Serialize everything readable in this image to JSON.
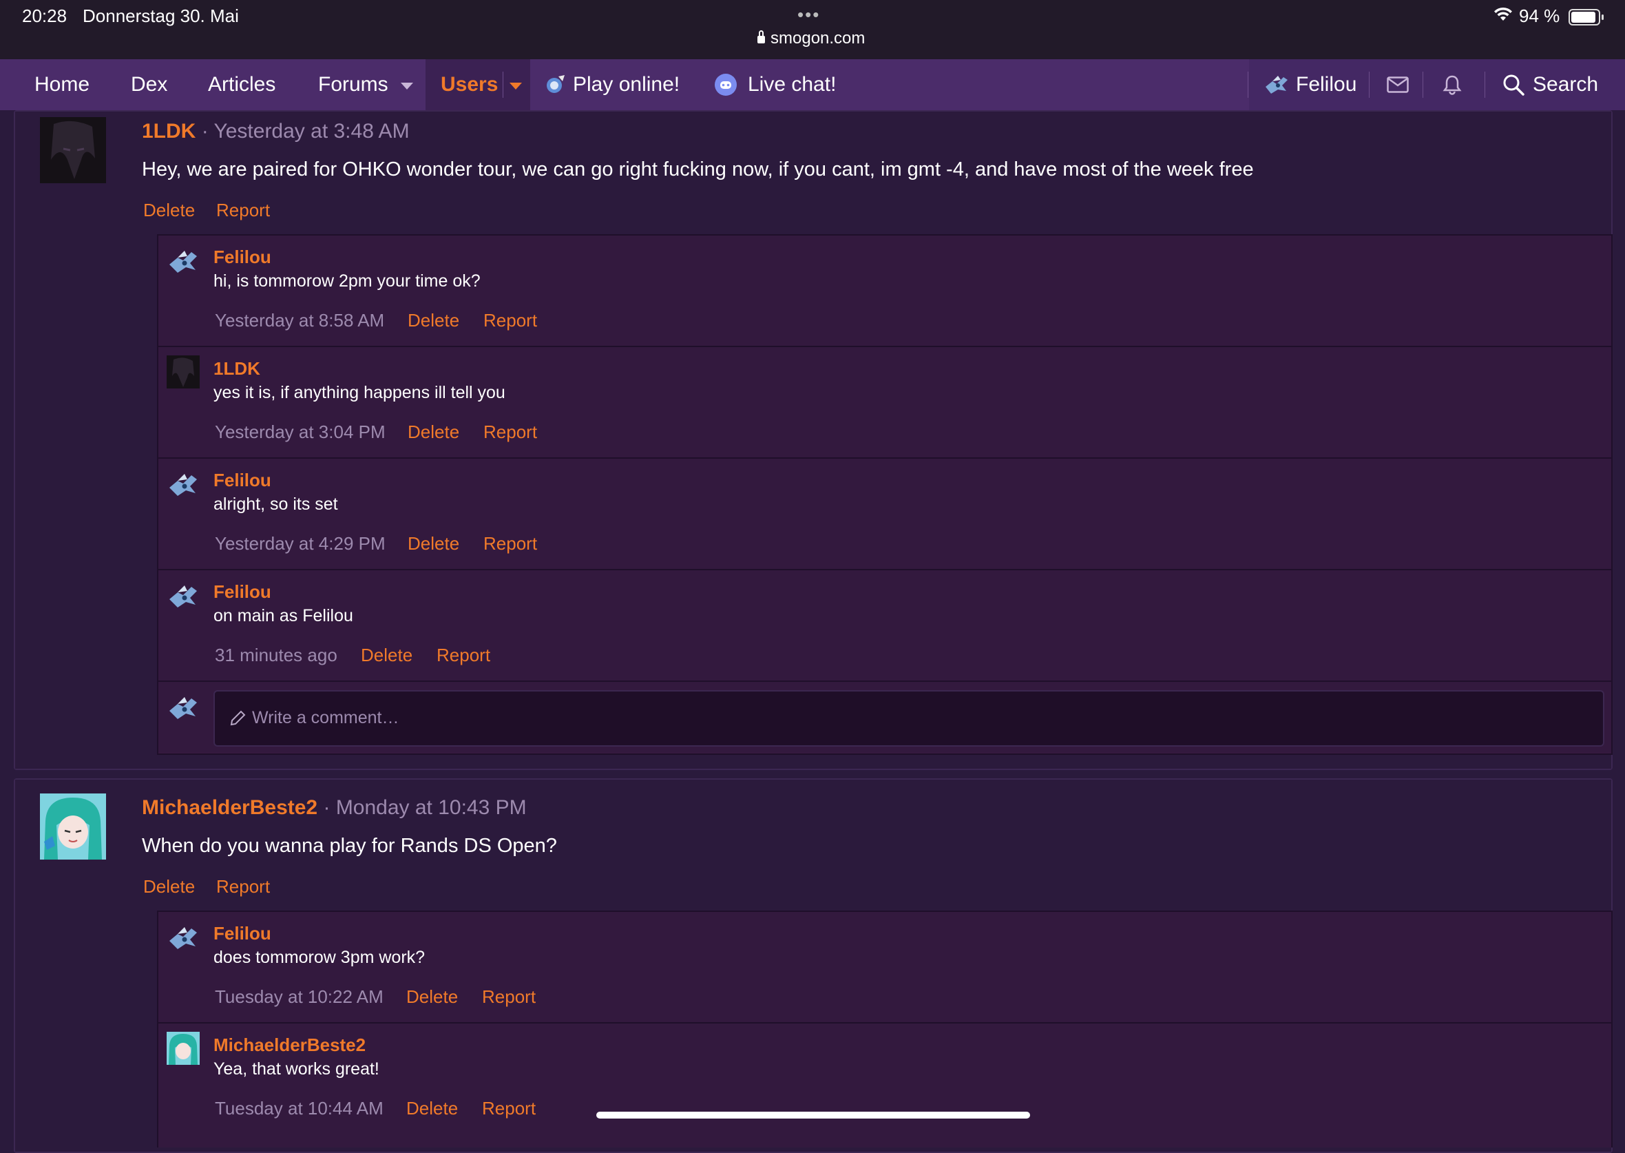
{
  "status_bar": {
    "time": "20:28",
    "date": "Donnerstag 30. Mai",
    "dots": "•••",
    "url": "smogon.com",
    "battery": "94 %"
  },
  "nav": {
    "home": "Home",
    "dex": "Dex",
    "articles": "Articles",
    "forums": "Forums",
    "users": "Users",
    "play_online": "Play online!",
    "live_chat": "Live chat!",
    "username": "Felilou",
    "search": "Search"
  },
  "posts": [
    {
      "author": "1LDK",
      "separator": "·",
      "time": "Yesterday at 3:48 AM",
      "text": "Hey, we are paired for OHKO wonder tour, we can go right fucking now, if you cant, im gmt -4, and have most of the week free",
      "delete": "Delete",
      "report": "Report",
      "comments": [
        {
          "author": "Felilou",
          "text": "hi, is tommorow 2pm your time ok?",
          "time": "Yesterday at 8:58 AM",
          "delete": "Delete",
          "report": "Report"
        },
        {
          "author": "1LDK",
          "text": "yes it is, if anything happens ill tell you",
          "time": "Yesterday at 3:04 PM",
          "delete": "Delete",
          "report": "Report"
        },
        {
          "author": "Felilou",
          "text": "alright, so its set",
          "time": "Yesterday at 4:29 PM",
          "delete": "Delete",
          "report": "Report"
        },
        {
          "author": "Felilou",
          "text": "on main as Felilou",
          "time": "31 minutes ago",
          "delete": "Delete",
          "report": "Report"
        }
      ],
      "comment_placeholder": "Write a comment…"
    },
    {
      "author": "MichaelderBeste2",
      "separator": "·",
      "time": "Monday at 10:43 PM",
      "text": "When do you wanna play for Rands DS Open?",
      "delete": "Delete",
      "report": "Report",
      "comments": [
        {
          "author": "Felilou",
          "text": "does tommorow 3pm work?",
          "time": "Tuesday at 10:22 AM",
          "delete": "Delete",
          "report": "Report"
        },
        {
          "author": "MichaelderBeste2",
          "text": "Yea, that works great!",
          "time": "Tuesday at 10:44 AM",
          "delete": "Delete",
          "report": "Report"
        }
      ]
    }
  ],
  "colors": {
    "accent": "#f07a2a",
    "nav_bg": "#4b2c6a",
    "page_bg": "#2a1a3c",
    "comment_bg": "#33193e",
    "muted_text": "#9d8aae"
  },
  "icons": [
    "lock-icon",
    "wifi-icon",
    "battery-icon",
    "chevron-down-icon",
    "play-online-icon",
    "discord-icon",
    "user-avatar-icon",
    "mail-icon",
    "bell-icon",
    "search-icon",
    "pencil-icon"
  ]
}
